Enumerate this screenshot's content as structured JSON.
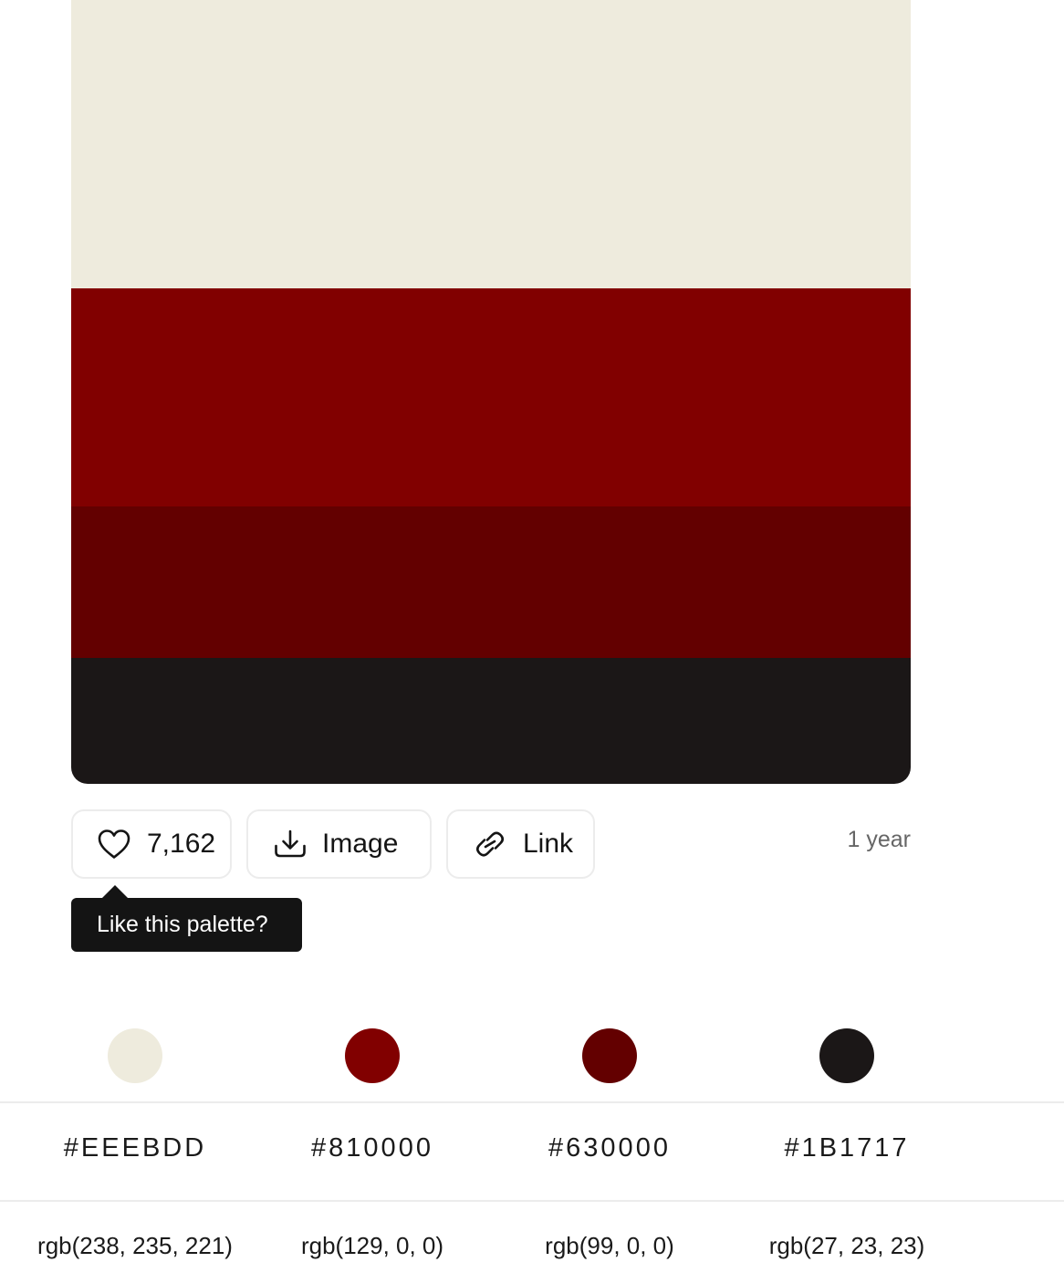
{
  "palette": {
    "colors": [
      {
        "hex": "#EEEBDD",
        "rgb": "rgb(238, 235, 221)",
        "value": "#eeebdd"
      },
      {
        "hex": "#810000",
        "rgb": "rgb(129, 0, 0)",
        "value": "#810000"
      },
      {
        "hex": "#630000",
        "rgb": "rgb(99, 0, 0)",
        "value": "#630000"
      },
      {
        "hex": "#1B1717",
        "rgb": "rgb(27, 23, 23)",
        "value": "#1b1717"
      }
    ]
  },
  "actions": {
    "like_count": "7,162",
    "like_icon": "heart-icon",
    "image_label": "Image",
    "image_icon": "download-icon",
    "link_label": "Link",
    "link_icon": "link-icon"
  },
  "meta": {
    "age": "1 year"
  },
  "tooltip": {
    "text": "Like this palette?"
  }
}
